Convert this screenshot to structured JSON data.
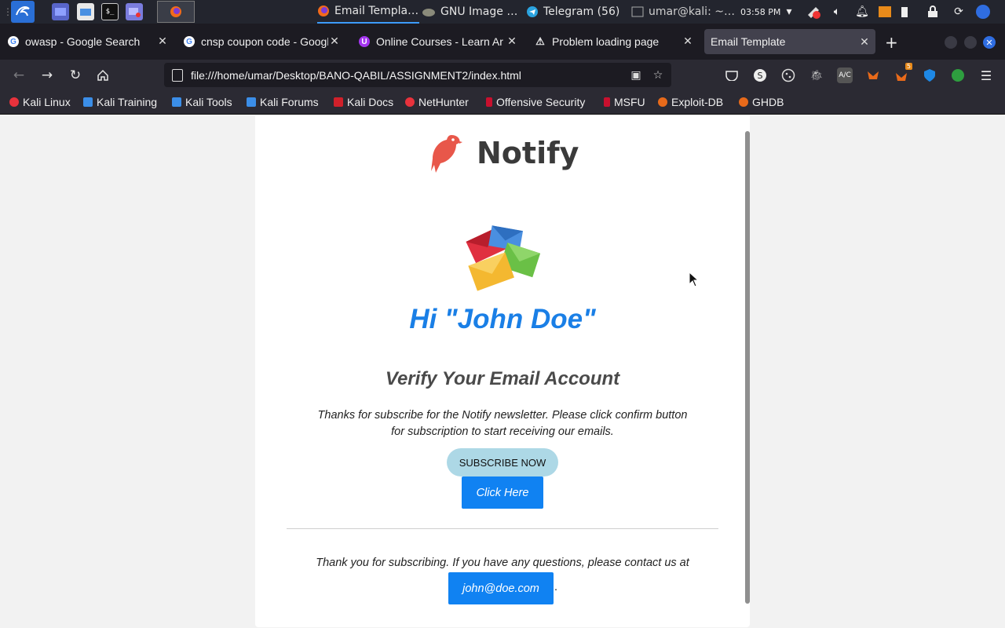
{
  "taskbar": {
    "tasks": [
      {
        "label": "Email Templa…",
        "icon": "firefox-icon"
      },
      {
        "label": "GNU Image …",
        "icon": "gimp-icon"
      },
      {
        "label": "Telegram (56)",
        "icon": "telegram-icon"
      },
      {
        "label": "umar@kali: ~…",
        "icon": "terminal-icon"
      }
    ],
    "clock": "03:58 PM",
    "notification_badge": "56"
  },
  "browser": {
    "tabs": [
      {
        "title": "owasp - Google Search",
        "icon": "google-icon"
      },
      {
        "title": "cnsp coupon code - Googl",
        "icon": "google-icon"
      },
      {
        "title": "Online Courses - Learn Ar",
        "icon": "udemy-icon"
      },
      {
        "title": "Problem loading page",
        "icon": "warning-icon"
      },
      {
        "title": "Email Template",
        "icon": "none",
        "active": true
      }
    ],
    "url": "file:///home/umar/Desktop/BANO-QABIL/ASSIGNMENT2/index.html",
    "extension_badge": "5",
    "bookmarks": [
      {
        "label": "Kali Linux",
        "color": "#e8323c"
      },
      {
        "label": "Kali Training",
        "color": "#3b8ee8"
      },
      {
        "label": "Kali Tools",
        "color": "#3b8ee8"
      },
      {
        "label": "Kali Forums",
        "color": "#3b8ee8"
      },
      {
        "label": "Kali Docs",
        "color": "#d0202a"
      },
      {
        "label": "NetHunter",
        "color": "#e8323c"
      },
      {
        "label": "Offensive Security",
        "color": "#c8102e"
      },
      {
        "label": "MSFU",
        "color": "#c8102e"
      },
      {
        "label": "Exploit-DB",
        "color": "#e86a1a"
      },
      {
        "label": "GHDB",
        "color": "#e86a1a"
      }
    ]
  },
  "email": {
    "brand": "Notify",
    "greeting": "Hi \"John Doe\"",
    "subtitle": "Verify Your Email Account",
    "body": "Thanks for subscribe for the Notify newsletter. Please click confirm button for subscription to start receiving our emails.",
    "subscribe_label": "SUBSCRIBE NOW",
    "click_label": "Click Here",
    "footer": "Thank you for subscribing. If you have any questions, please contact us at",
    "email_label": "john@doe.com",
    "footer_dot": ".",
    "colors": {
      "accent": "#1a7fe6",
      "button": "#1082f2",
      "subscribe": "#add8e6",
      "brand_bird": "#e8574a"
    }
  }
}
